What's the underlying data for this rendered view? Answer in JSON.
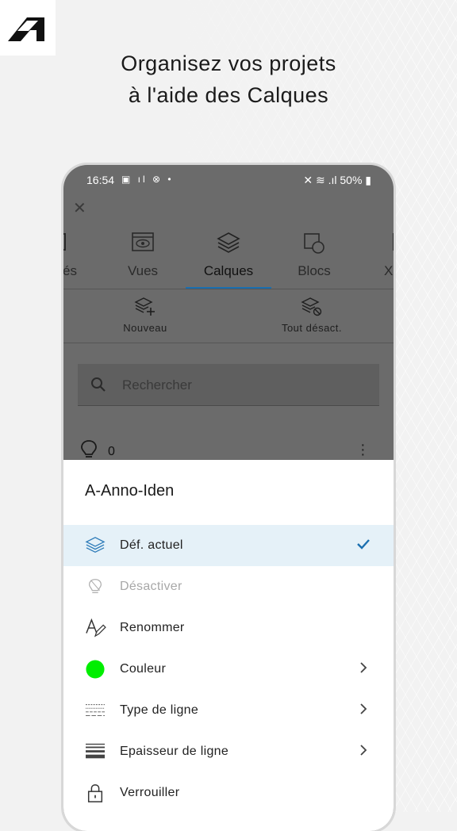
{
  "headline": {
    "line1": "Organisez vos projets",
    "line2": "à l'aide des Calques"
  },
  "statusbar": {
    "time": "16:54",
    "battery": "50%"
  },
  "tabs": [
    {
      "label": "és",
      "icon": "tab-partial-icon"
    },
    {
      "label": "Vues",
      "icon": "eye-icon"
    },
    {
      "label": "Calques",
      "icon": "layers-icon"
    },
    {
      "label": "Blocs",
      "icon": "blocks-icon"
    },
    {
      "label": "X",
      "icon": "xref-icon"
    }
  ],
  "actions": {
    "new": "Nouveau",
    "all_off": "Tout désact."
  },
  "search": {
    "placeholder": "Rechercher"
  },
  "layer_row": {
    "name": "0"
  },
  "sheet": {
    "title": "A-Anno-Iden",
    "options": [
      {
        "label": "Déf. actuel",
        "icon": "layers-icon",
        "selected": true
      },
      {
        "label": "Désactiver",
        "icon": "bulb-off-icon",
        "disabled": true
      },
      {
        "label": "Renommer",
        "icon": "rename-icon"
      },
      {
        "label": "Couleur",
        "icon": "color-swatch-icon",
        "color": "#00ee00"
      },
      {
        "label": "Type de ligne",
        "icon": "linetype-icon"
      },
      {
        "label": "Epaisseur de ligne",
        "icon": "lineweight-icon"
      },
      {
        "label": "Verrouiller",
        "icon": "lock-icon"
      }
    ]
  },
  "colors": {
    "accent": "#1a6fb0",
    "selected_bg": "#e5f1f8",
    "layer_color": "#00ee00"
  }
}
